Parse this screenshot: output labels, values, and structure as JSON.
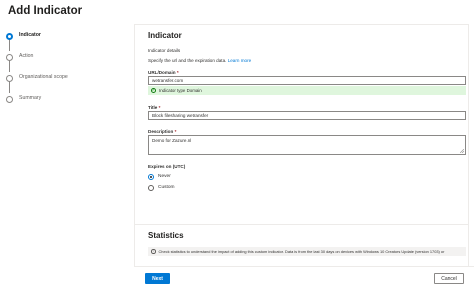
{
  "header": {
    "title": "Add Indicator"
  },
  "steps": [
    {
      "label": "Indicator",
      "active": true
    },
    {
      "label": "Action",
      "active": false
    },
    {
      "label": "Organizational scope",
      "active": false
    },
    {
      "label": "Summary",
      "active": false
    }
  ],
  "indicator": {
    "heading": "Indicator",
    "details_label": "Indicator details",
    "description_text": "Specify the url and the expiration data.",
    "learn_more": "Learn more",
    "url_label": "URL/Domain",
    "url_value": "wetransfer.com",
    "url_validation": "Indicator type Domain",
    "title_label": "Title",
    "title_value": "Block filesharing wetransfer",
    "description_label": "Description",
    "description_value": "Demo for Zazure.nl",
    "required_mark": "*",
    "expires_label": "Expires on (UTC)",
    "expires_options": [
      {
        "label": "Never",
        "selected": true
      },
      {
        "label": "Custom",
        "selected": false
      }
    ]
  },
  "statistics": {
    "heading": "Statistics",
    "info_text": "Check statistics to understand the impact of adding this custom indicator. Data is from the last 30 days on devices with Windows 10 Creators Update (version 1703) or"
  },
  "footer": {
    "next_label": "Next",
    "cancel_label": "Cancel"
  },
  "colors": {
    "accent": "#0078d4",
    "success_bg": "#dff6dd",
    "success_icon": "#107c10"
  }
}
